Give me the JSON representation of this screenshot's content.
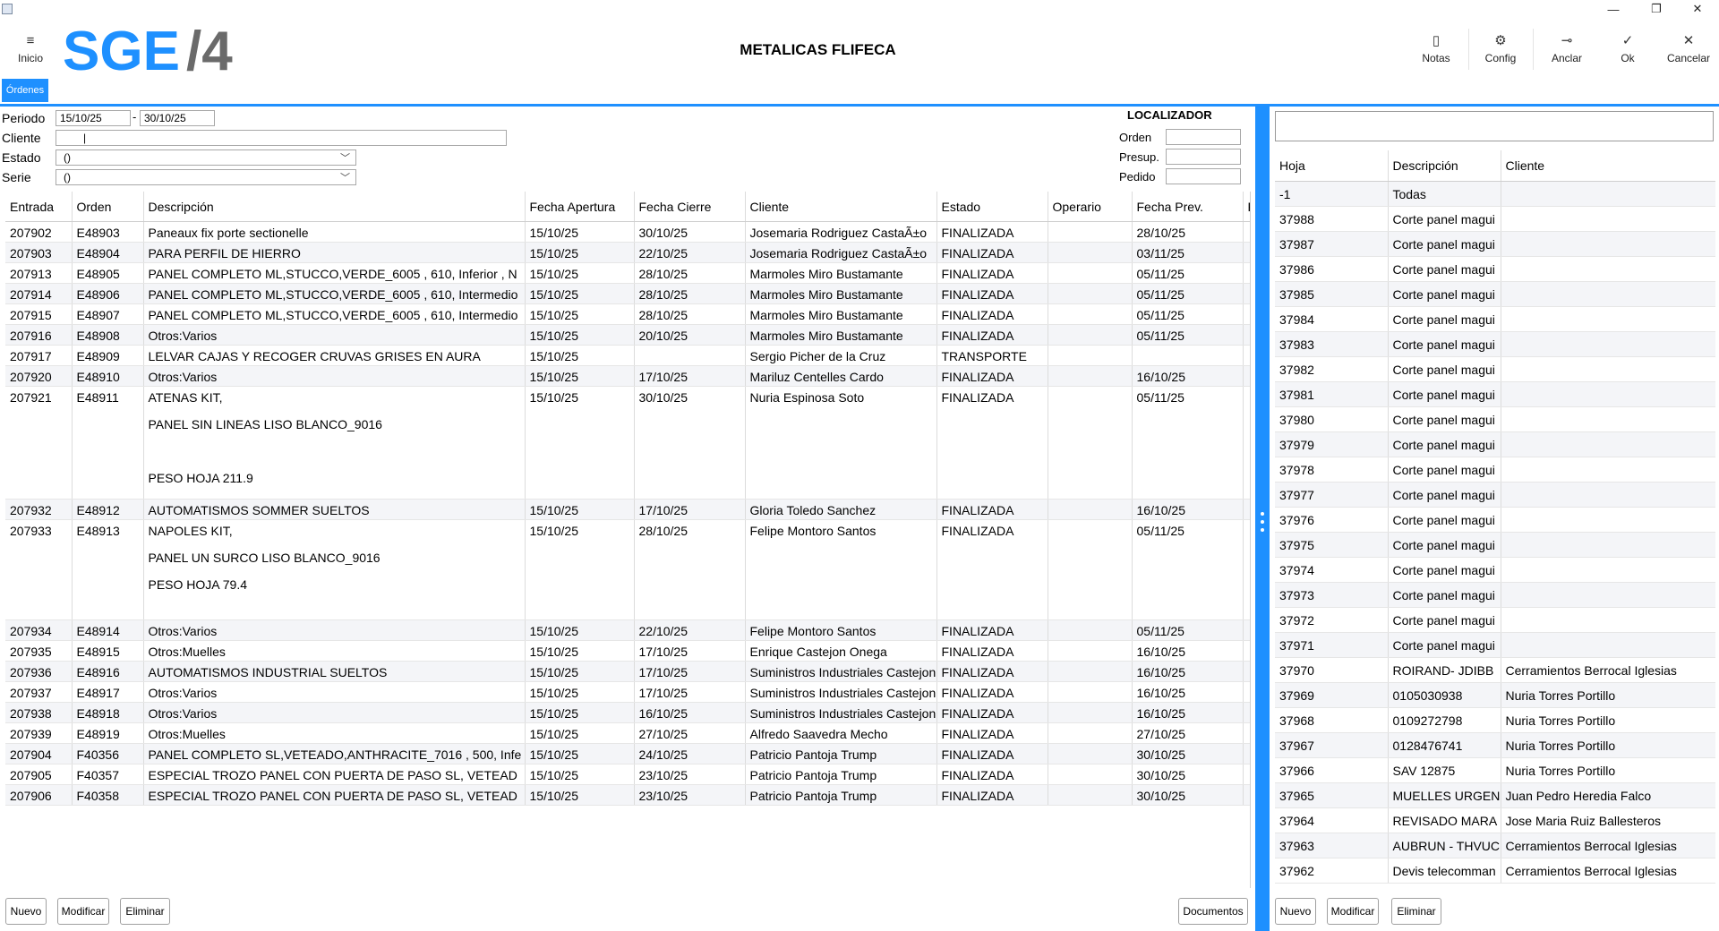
{
  "window": {
    "minimize_label": "—",
    "maximize_label": "❐",
    "close_label": "✕"
  },
  "header": {
    "menu_label": "Inicio",
    "logo_text": "SGE/4",
    "title": "METALICAS FLIFECA",
    "buttons": [
      {
        "label": "Notas",
        "icon": "note-icon"
      },
      {
        "label": "Config",
        "icon": "gear-icon"
      },
      {
        "label": "Anclar",
        "icon": "pin-icon"
      },
      {
        "label": "Ok",
        "icon": "check-icon"
      },
      {
        "label": "Cancelar",
        "icon": "close-icon"
      }
    ]
  },
  "tabs": [
    {
      "label": "Órdenes"
    }
  ],
  "filters": {
    "periodo_label": "Periodo",
    "periodo_from": "15/10/25",
    "periodo_sep": "-",
    "periodo_to": "30/10/25",
    "cliente_label": "Cliente",
    "cliente_value": "|",
    "estado_label": "Estado",
    "estado_value": "()",
    "serie_label": "Serie",
    "serie_value": "()",
    "localizador_title": "LOCALIZADOR",
    "orden_label": "Orden",
    "presup_label": "Presup.",
    "pedido_label": "Pedido"
  },
  "orders": {
    "columns": [
      "Entrada",
      "Orden",
      "Descripción",
      "Fecha Apertura",
      "Fecha Cierre",
      "Cliente",
      "Estado",
      "Operario",
      "Fecha Prev.",
      "F"
    ],
    "rows": [
      {
        "entrada": "207902",
        "orden": "E48903",
        "descripcion": [
          "Paneaux fix porte sectionelle"
        ],
        "apertura": "15/10/25",
        "cierre": "30/10/25",
        "cliente": "Josemaria Rodriguez CastaÃ±o",
        "estado": "FINALIZADA",
        "operario": "",
        "prev": "28/10/25"
      },
      {
        "entrada": "207903",
        "orden": "E48904",
        "descripcion": [
          "PARA PERFIL DE HIERRO"
        ],
        "apertura": "15/10/25",
        "cierre": "22/10/25",
        "cliente": "Josemaria Rodriguez CastaÃ±o",
        "estado": "FINALIZADA",
        "operario": "",
        "prev": "03/11/25"
      },
      {
        "entrada": "207913",
        "orden": "E48905",
        "descripcion": [
          "PANEL COMPLETO ML,STUCCO,VERDE_6005 , 610, Inferior , N"
        ],
        "apertura": "15/10/25",
        "cierre": "28/10/25",
        "cliente": "Marmoles Miro Bustamante",
        "estado": "FINALIZADA",
        "operario": "",
        "prev": "05/11/25"
      },
      {
        "entrada": "207914",
        "orden": "E48906",
        "descripcion": [
          "PANEL COMPLETO ML,STUCCO,VERDE_6005 , 610, Intermedio"
        ],
        "apertura": "15/10/25",
        "cierre": "28/10/25",
        "cliente": "Marmoles Miro Bustamante",
        "estado": "FINALIZADA",
        "operario": "",
        "prev": "05/11/25"
      },
      {
        "entrada": "207915",
        "orden": "E48907",
        "descripcion": [
          "PANEL COMPLETO ML,STUCCO,VERDE_6005 , 610, Intermedio"
        ],
        "apertura": "15/10/25",
        "cierre": "28/10/25",
        "cliente": "Marmoles Miro Bustamante",
        "estado": "FINALIZADA",
        "operario": "",
        "prev": "05/11/25"
      },
      {
        "entrada": "207916",
        "orden": "E48908",
        "descripcion": [
          "Otros:Varios"
        ],
        "apertura": "15/10/25",
        "cierre": "20/10/25",
        "cliente": "Marmoles Miro Bustamante",
        "estado": "FINALIZADA",
        "operario": "",
        "prev": "05/11/25"
      },
      {
        "entrada": "207917",
        "orden": "E48909",
        "descripcion": [
          "LELVAR CAJAS  Y RECOGER CRUVAS GRISES EN AURA"
        ],
        "apertura": "15/10/25",
        "cierre": "",
        "cliente": "Sergio Picher de la Cruz",
        "estado": "TRANSPORTE",
        "operario": "",
        "prev": ""
      },
      {
        "entrada": "207920",
        "orden": "E48910",
        "descripcion": [
          "Otros:Varios"
        ],
        "apertura": "15/10/25",
        "cierre": "17/10/25",
        "cliente": "Mariluz Centelles Cardo",
        "estado": "FINALIZADA",
        "operario": "",
        "prev": "16/10/25"
      },
      {
        "entrada": "207921",
        "orden": "E48911",
        "descripcion": [
          "ATENAS  KIT,",
          "PANEL SIN LINEAS LISO BLANCO_9016",
          "",
          "PESO HOJA 211.9"
        ],
        "apertura": "15/10/25",
        "cierre": "30/10/25",
        "cliente": "Nuria Espinosa Soto",
        "estado": "FINALIZADA",
        "operario": "",
        "prev": "05/11/25"
      },
      {
        "entrada": "207932",
        "orden": "E48912",
        "descripcion": [
          "AUTOMATISMOS SOMMER SUELTOS"
        ],
        "apertura": "15/10/25",
        "cierre": "17/10/25",
        "cliente": "Gloria Toledo Sanchez",
        "estado": "FINALIZADA",
        "operario": "",
        "prev": "16/10/25"
      },
      {
        "entrada": "207933",
        "orden": "E48913",
        "descripcion": [
          "NAPOLES  KIT,",
          "PANEL UN SURCO LISO BLANCO_9016",
          "PESO HOJA 79.4"
        ],
        "apertura": "15/10/25",
        "cierre": "28/10/25",
        "cliente": "Felipe Montoro Santos",
        "estado": "FINALIZADA",
        "operario": "",
        "prev": "05/11/25"
      },
      {
        "entrada": "207934",
        "orden": "E48914",
        "descripcion": [
          "Otros:Varios"
        ],
        "apertura": "15/10/25",
        "cierre": "22/10/25",
        "cliente": "Felipe Montoro Santos",
        "estado": "FINALIZADA",
        "operario": "",
        "prev": "05/11/25"
      },
      {
        "entrada": "207935",
        "orden": "E48915",
        "descripcion": [
          "Otros:Muelles"
        ],
        "apertura": "15/10/25",
        "cierre": "17/10/25",
        "cliente": "Enrique Castejon Onega",
        "estado": "FINALIZADA",
        "operario": "",
        "prev": "16/10/25"
      },
      {
        "entrada": "207936",
        "orden": "E48916",
        "descripcion": [
          "AUTOMATISMOS INDUSTRIAL SUELTOS"
        ],
        "apertura": "15/10/25",
        "cierre": "17/10/25",
        "cliente": "Suministros Industriales Castejon",
        "estado": "FINALIZADA",
        "operario": "",
        "prev": "16/10/25"
      },
      {
        "entrada": "207937",
        "orden": "E48917",
        "descripcion": [
          "Otros:Varios"
        ],
        "apertura": "15/10/25",
        "cierre": "17/10/25",
        "cliente": "Suministros Industriales Castejon",
        "estado": "FINALIZADA",
        "operario": "",
        "prev": "16/10/25"
      },
      {
        "entrada": "207938",
        "orden": "E48918",
        "descripcion": [
          "Otros:Varios"
        ],
        "apertura": "15/10/25",
        "cierre": "16/10/25",
        "cliente": "Suministros Industriales Castejon",
        "estado": "FINALIZADA",
        "operario": "",
        "prev": "16/10/25"
      },
      {
        "entrada": "207939",
        "orden": "E48919",
        "descripcion": [
          "Otros:Muelles"
        ],
        "apertura": "15/10/25",
        "cierre": "27/10/25",
        "cliente": "Alfredo Saavedra Mecho",
        "estado": "FINALIZADA",
        "operario": "",
        "prev": "27/10/25"
      },
      {
        "entrada": "207904",
        "orden": "F40356",
        "descripcion": [
          "PANEL COMPLETO SL,VETEADO,ANTHRACITE_7016 , 500, Infe"
        ],
        "apertura": "15/10/25",
        "cierre": "24/10/25",
        "cliente": "Patricio Pantoja Trump",
        "estado": "FINALIZADA",
        "operario": "",
        "prev": "30/10/25"
      },
      {
        "entrada": "207905",
        "orden": "F40357",
        "descripcion": [
          "ESPECIAL TROZO PANEL CON PUERTA DE PASO  SL, VETEAD"
        ],
        "apertura": "15/10/25",
        "cierre": "23/10/25",
        "cliente": "Patricio Pantoja Trump",
        "estado": "FINALIZADA",
        "operario": "",
        "prev": "30/10/25"
      },
      {
        "entrada": "207906",
        "orden": "F40358",
        "descripcion": [
          "ESPECIAL TROZO PANEL CON PUERTA DE PASO  SL, VETEAD"
        ],
        "apertura": "15/10/25",
        "cierre": "23/10/25",
        "cliente": "Patricio Pantoja Trump",
        "estado": "FINALIZADA",
        "operario": "",
        "prev": "30/10/25"
      }
    ]
  },
  "left_buttons": {
    "nuevo": "Nuevo",
    "modificar": "Modificar",
    "eliminar": "Eliminar",
    "documentos": "Documentos"
  },
  "right_panel": {
    "columns": [
      "Hoja",
      "Descripción",
      "Cliente"
    ],
    "rows": [
      {
        "hoja": "-1",
        "descripcion": "Todas",
        "cliente": ""
      },
      {
        "hoja": "37988",
        "descripcion": "Corte panel magui",
        "cliente": ""
      },
      {
        "hoja": "37987",
        "descripcion": "Corte panel magui",
        "cliente": ""
      },
      {
        "hoja": "37986",
        "descripcion": "Corte panel magui",
        "cliente": ""
      },
      {
        "hoja": "37985",
        "descripcion": "Corte panel magui",
        "cliente": ""
      },
      {
        "hoja": "37984",
        "descripcion": "Corte panel magui",
        "cliente": ""
      },
      {
        "hoja": "37983",
        "descripcion": "Corte panel magui",
        "cliente": ""
      },
      {
        "hoja": "37982",
        "descripcion": "Corte panel magui",
        "cliente": ""
      },
      {
        "hoja": "37981",
        "descripcion": "Corte panel magui",
        "cliente": ""
      },
      {
        "hoja": "37980",
        "descripcion": "Corte panel magui",
        "cliente": ""
      },
      {
        "hoja": "37979",
        "descripcion": "Corte panel magui",
        "cliente": ""
      },
      {
        "hoja": "37978",
        "descripcion": "Corte panel magui",
        "cliente": ""
      },
      {
        "hoja": "37977",
        "descripcion": "Corte panel magui",
        "cliente": ""
      },
      {
        "hoja": "37976",
        "descripcion": "Corte panel magui",
        "cliente": ""
      },
      {
        "hoja": "37975",
        "descripcion": "Corte panel magui",
        "cliente": ""
      },
      {
        "hoja": "37974",
        "descripcion": "Corte panel magui",
        "cliente": ""
      },
      {
        "hoja": "37973",
        "descripcion": "Corte panel magui",
        "cliente": ""
      },
      {
        "hoja": "37972",
        "descripcion": "Corte panel magui",
        "cliente": ""
      },
      {
        "hoja": "37971",
        "descripcion": "Corte panel magui",
        "cliente": ""
      },
      {
        "hoja": "37970",
        "descripcion": "ROIRAND- JDIBB",
        "cliente": "Cerramientos Berrocal Iglesias"
      },
      {
        "hoja": "37969",
        "descripcion": "0105030938",
        "cliente": "Nuria Torres Portillo"
      },
      {
        "hoja": "37968",
        "descripcion": "0109272798",
        "cliente": "Nuria Torres Portillo"
      },
      {
        "hoja": "37967",
        "descripcion": "0128476741",
        "cliente": "Nuria Torres Portillo"
      },
      {
        "hoja": "37966",
        "descripcion": "SAV 12875",
        "cliente": "Nuria Torres Portillo"
      },
      {
        "hoja": "37965",
        "descripcion": "MUELLES URGEN",
        "cliente": "Juan Pedro Heredia Falco"
      },
      {
        "hoja": "37964",
        "descripcion": "REVISADO MARA",
        "cliente": "Jose Maria Ruiz Ballesteros"
      },
      {
        "hoja": "37963",
        "descripcion": "AUBRUN - THVUC",
        "cliente": "Cerramientos Berrocal Iglesias"
      },
      {
        "hoja": "37962",
        "descripcion": "Devis telecomman",
        "cliente": "Cerramientos Berrocal Iglesias"
      }
    ],
    "buttons": {
      "nuevo": "Nuevo",
      "modificar": "Modificar",
      "eliminar": "Eliminar"
    }
  },
  "colors": {
    "accent": "#1e90ff"
  }
}
